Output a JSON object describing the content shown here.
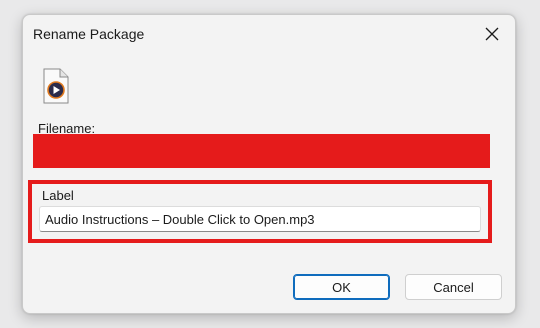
{
  "dialog": {
    "title": "Rename Package",
    "close_icon": "close-icon",
    "file_icon": "media-file-icon",
    "filename_label": "Filename:",
    "label_caption": "Label",
    "label_value": "Audio Instructions – Double Click to Open.mp3",
    "ok_label": "OK",
    "cancel_label": "Cancel"
  },
  "colors": {
    "redaction": "#e51b1b",
    "highlight_border": "#e51b1b",
    "accent": "#0f6cbd"
  }
}
